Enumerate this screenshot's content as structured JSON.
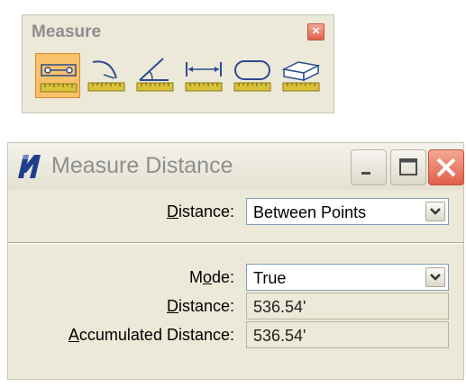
{
  "toolbar": {
    "title": "Measure",
    "close_label": "×",
    "tools": [
      {
        "name": "measure-distance-tool-icon",
        "active": true
      },
      {
        "name": "measure-radius-tool-icon",
        "active": false
      },
      {
        "name": "measure-angle-tool-icon",
        "active": false
      },
      {
        "name": "measure-length-tool-icon",
        "active": false
      },
      {
        "name": "measure-area-tool-icon",
        "active": false
      },
      {
        "name": "measure-volume-tool-icon",
        "active": false
      }
    ]
  },
  "window": {
    "title": "Measure Distance",
    "distance_method": {
      "label_prefix": "",
      "label_underlined": "D",
      "label_suffix": "istance:",
      "value": "Between Points"
    },
    "mode": {
      "label_prefix": "M",
      "label_underlined": "o",
      "label_suffix": "de:",
      "value": "True"
    },
    "distance_result": {
      "label_prefix": "",
      "label_underlined": "D",
      "label_suffix": "istance:",
      "value": "536.54'"
    },
    "accumulated_result": {
      "label_prefix": "",
      "label_underlined": "A",
      "label_suffix": "ccumulated Distance:",
      "value": "536.54'"
    }
  },
  "colors": {
    "dialog_bg": "#ece9d8",
    "active_tool": "#f9c26a",
    "close_red": "#df5f48",
    "icon_line": "#2b4c8c",
    "ruler_yellow": "#d9c23a"
  }
}
